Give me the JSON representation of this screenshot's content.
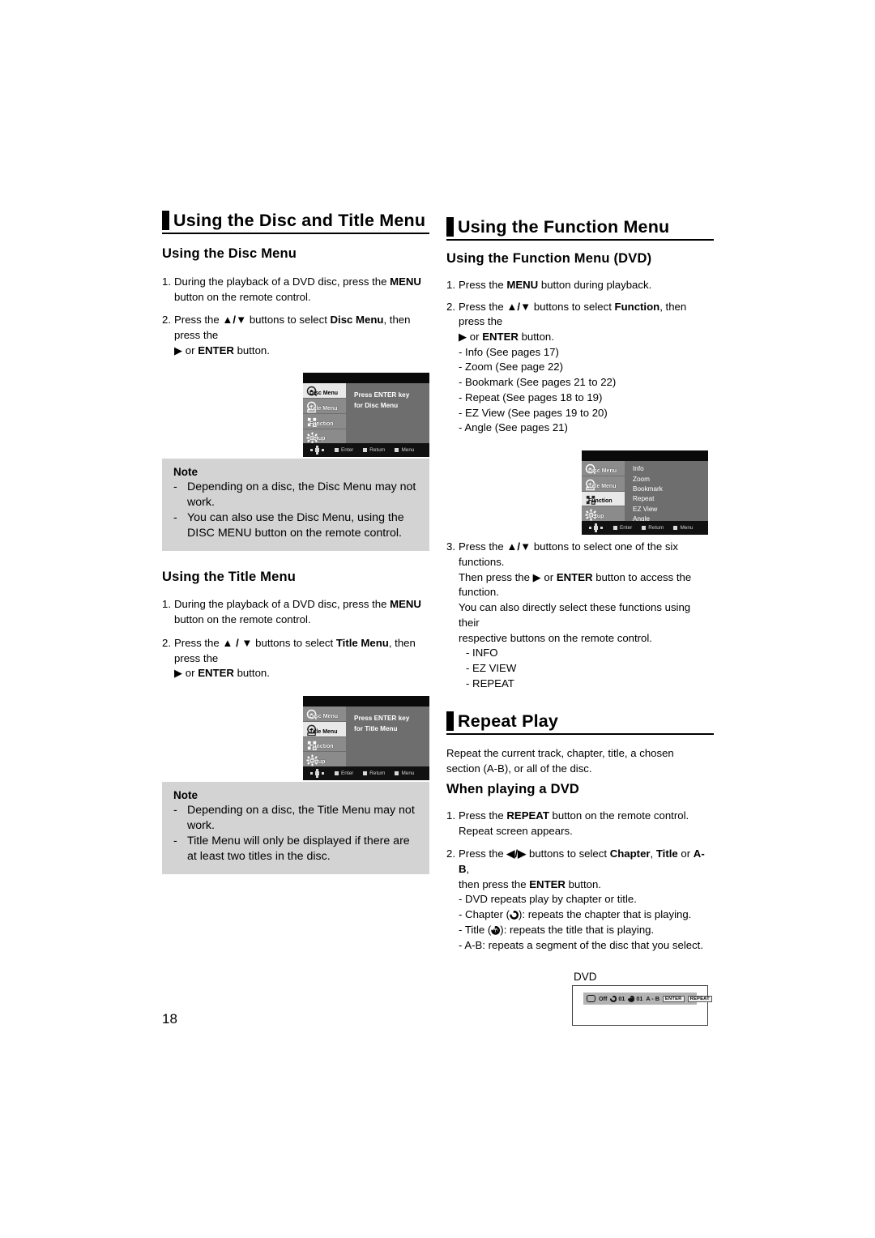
{
  "page": {
    "number": "18"
  },
  "left_column": {
    "heading": "Using the Disc and Title Menu",
    "disc_menu": {
      "subheading": "Using the Disc Menu",
      "step1_num": "1.",
      "step1_a": "During the playback of a DVD disc, press the ",
      "step1_b": "MENU",
      "step1_c": " button on the remote control.",
      "step2_num": "2.",
      "step2_a": "Press the ",
      "step2_arrows": "▲/▼",
      "step2_b": " buttons to select ",
      "step2_c": "Disc Menu",
      "step2_d": ", then press the ",
      "step2_e": "▶ or ",
      "step2_f": "ENTER",
      "step2_g": " button."
    },
    "disc_menu_screen": {
      "message_line1": "Press ENTER key",
      "message_line2": "for Disc Menu",
      "sidebar": [
        "Disc Menu",
        "Title Menu",
        "Function",
        "Setup"
      ],
      "selected": "Disc Menu",
      "bottom_hints": [
        "Enter",
        "Return",
        "Menu"
      ]
    },
    "note1": {
      "title": "Note",
      "items": [
        "Depending on a disc, the Disc Menu may not work.",
        "You can also use the Disc Menu, using the DISC MENU button on the remote control."
      ]
    },
    "title_menu": {
      "subheading": "Using the Title Menu",
      "step1_num": "1.",
      "step1_a": "During the playback of a DVD disc, press the ",
      "step1_b": "MENU",
      "step1_c": " button on the remote control.",
      "step2_num": "2.",
      "step2_a": "Press the ",
      "step2_arrows": "▲ / ▼",
      "step2_b": " buttons to select ",
      "step2_c": "Title Menu",
      "step2_d": ", then press the ",
      "step2_e": "▶ or ",
      "step2_f": "ENTER",
      "step2_g": " button."
    },
    "title_menu_screen": {
      "message_line1": "Press ENTER key",
      "message_line2": "for Title Menu",
      "sidebar": [
        "Disc Menu",
        "Title Menu",
        "Function",
        "Setup"
      ],
      "selected": "Title Menu",
      "bottom_hints": [
        "Enter",
        "Return",
        "Menu"
      ]
    },
    "note2": {
      "title": "Note",
      "items": [
        "Depending on a disc, the Title Menu may not work.",
        "Title Menu will only be displayed if there are at least two titles in the disc."
      ]
    }
  },
  "right_column": {
    "heading": "Using the Function Menu",
    "function_menu": {
      "subheading": "Using the Function Menu (DVD)",
      "step1_num": "1.",
      "step1_a": "Press the ",
      "step1_b": "MENU",
      "step1_c": " button during playback.",
      "step2_num": "2.",
      "step2_a": "Press the ",
      "step2_arrows": "▲/▼",
      "step2_b": " buttons to select ",
      "step2_c": "Function",
      "step2_d": ", then press the ",
      "step2_e": "▶ or ",
      "step2_f": "ENTER",
      "step2_g": " button.",
      "references": [
        "- Info (See pages 17)",
        "- Zoom (See page 22)",
        "- Bookmark (See pages 21 to 22)",
        "- Repeat (See pages 18 to 19)",
        "- EZ View (See pages 19 to 20)",
        "- Angle (See pages 21)"
      ],
      "step3_num": "3.",
      "step3_a": "Press the ",
      "step3_arrows": "▲/▼",
      "step3_b": " buttons to select one of the six functions.",
      "step3_line2_a": "Then press the ▶ or ",
      "step3_line2_b": "ENTER",
      "step3_line2_c": " button to access the function.",
      "step3_line3": "You can also directly select these functions using their",
      "step3_line4": "respective buttons on the remote control.",
      "direct_buttons": [
        "- INFO",
        "- EZ VIEW",
        "- REPEAT"
      ]
    },
    "function_menu_screen": {
      "sidebar": [
        "Disc Menu",
        "Title Menu",
        "Function",
        "Setup"
      ],
      "selected": "Function",
      "items": [
        "Info",
        "Zoom",
        "Bookmark",
        "Repeat",
        "EZ View",
        "Angle"
      ],
      "bottom_hints": [
        "Enter",
        "Return",
        "Menu"
      ]
    },
    "repeat_play": {
      "heading": "Repeat Play",
      "intro_line1": "Repeat the current track, chapter, title, a chosen",
      "intro_line2": "section (A-B), or all of the disc.",
      "subheading": "When playing a DVD",
      "step1_num": "1.",
      "step1_a": "Press the ",
      "step1_b": "REPEAT",
      "step1_c": " button on the remote control.",
      "step1_line2": "Repeat screen appears.",
      "step2_num": "2.",
      "step2_a": "Press the ",
      "step2_arrows": "◀/▶",
      "step2_b": " buttons to select ",
      "step2_c": "Chapter",
      "step2_d": ", ",
      "step2_e": "Title",
      "step2_f": " or ",
      "step2_g": "A-B",
      "step2_h": ",",
      "step2_line2_a": "then press the ",
      "step2_line2_b": "ENTER",
      "step2_line2_c": " button.",
      "bullets": [
        {
          "pre": "- DVD repeats play by chapter or title.",
          "icon": null,
          "post": ""
        },
        {
          "pre": "- Chapter (",
          "icon": "repeat-chapter-icon",
          "post": "): repeats the chapter that is playing."
        },
        {
          "pre": "- Title (",
          "icon": "repeat-title-icon",
          "post": "): repeats the title that is playing."
        },
        {
          "pre": "- A-B: repeats a segment of the disc that you select.",
          "icon": null,
          "post": ""
        }
      ]
    },
    "dvd_figure": {
      "label": "DVD",
      "bar": {
        "tv_icon": "tv-icon",
        "off": "Off",
        "chapter_icon": "repeat-chapter-icon",
        "chapter_value": "01",
        "title_icon": "repeat-title-icon",
        "title_value": "01",
        "ab": "A - B",
        "key_enter": "ENTER",
        "key_repeat": "REPEAT"
      }
    }
  },
  "colors": {
    "note_bg": "#d3d3d3",
    "osd_panel": "#6e6e6e",
    "osd_sidebar": "#8b8b8b",
    "osd_selected": "#e8e8e8"
  }
}
